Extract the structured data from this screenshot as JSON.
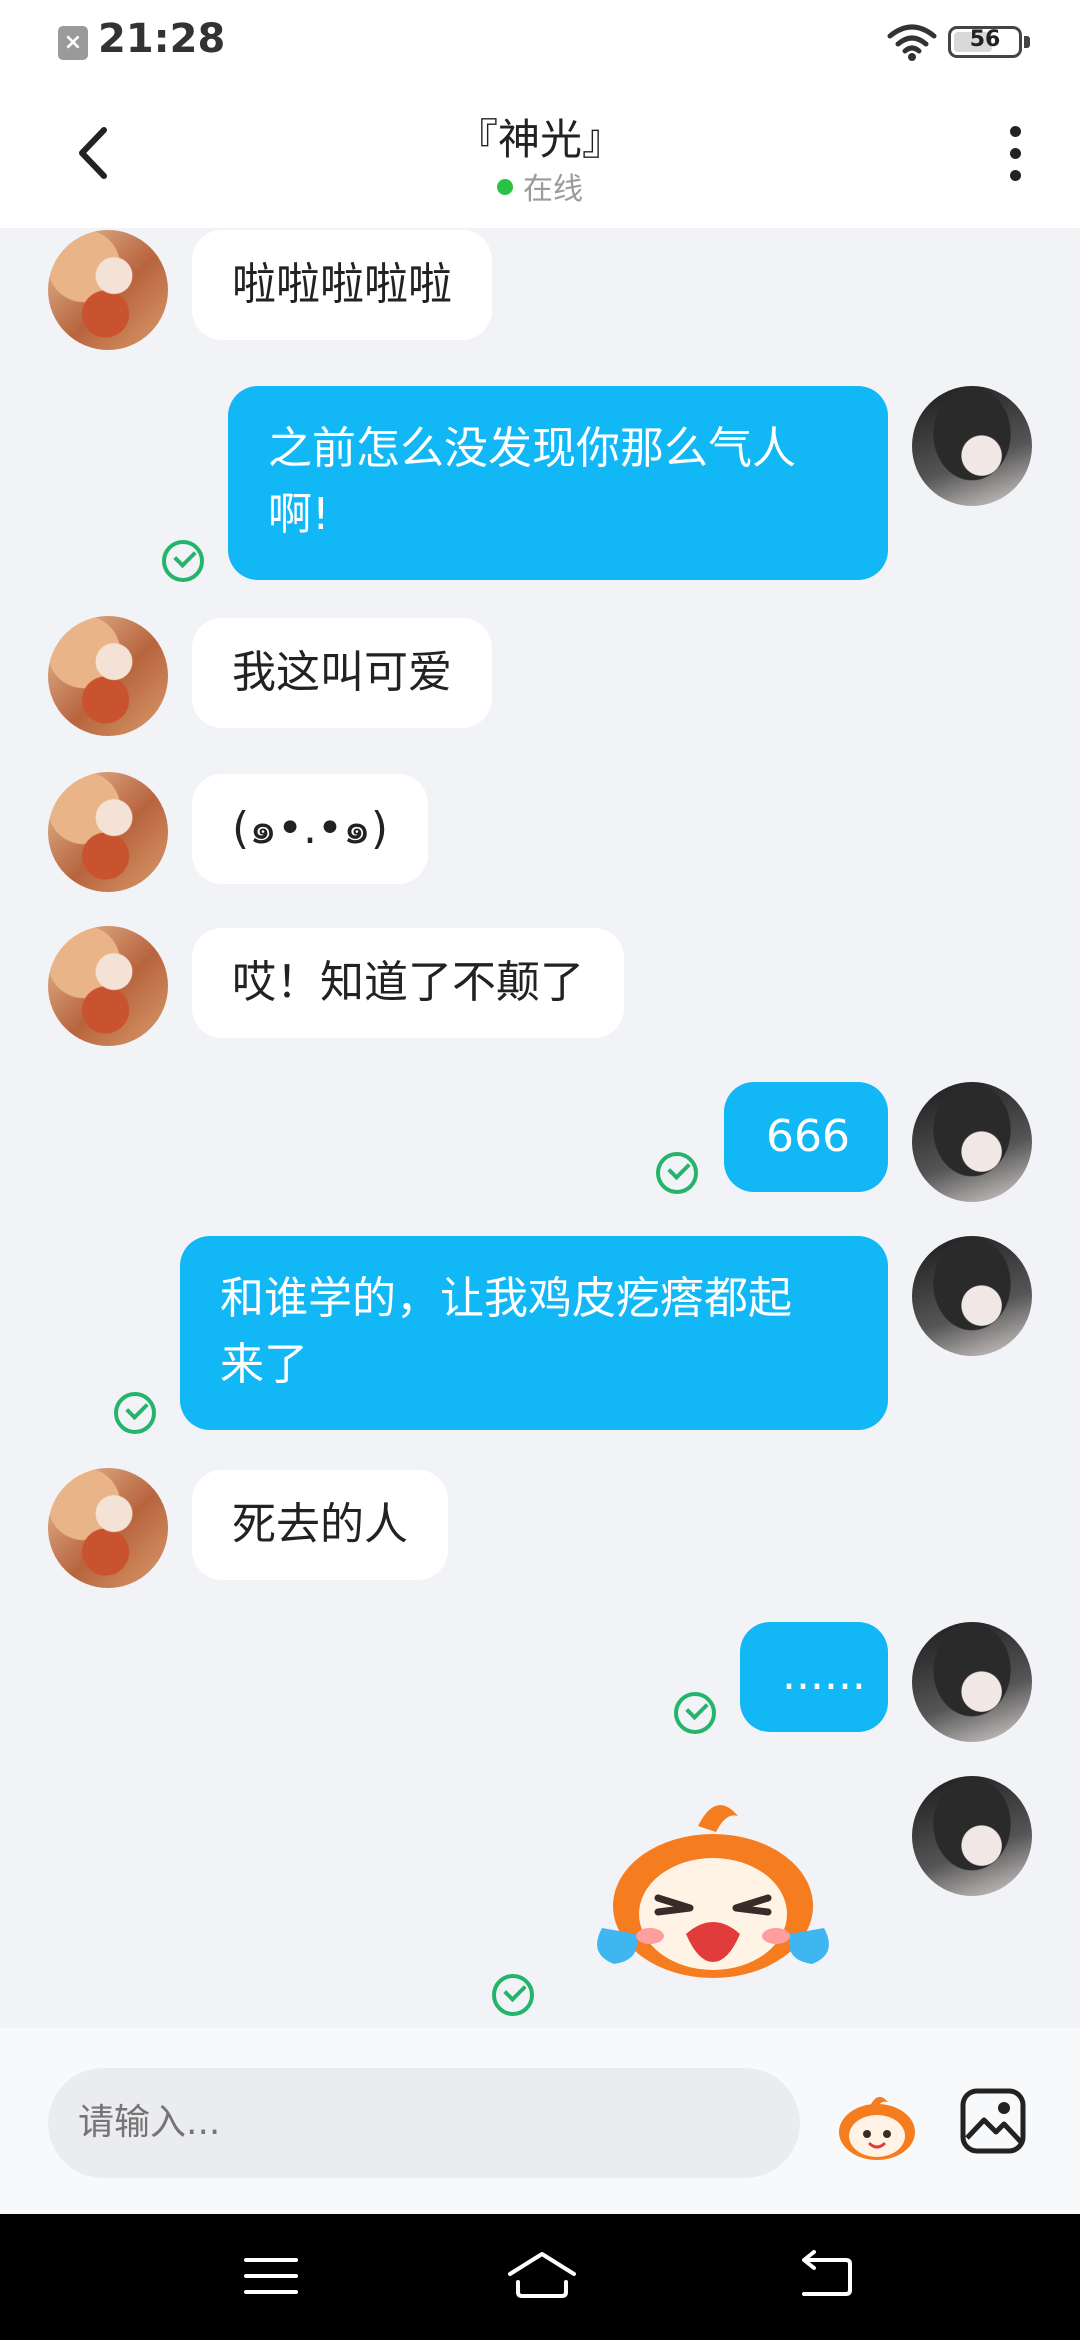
{
  "status_bar": {
    "time": "21:28",
    "battery": "56",
    "notification_icon": "x-icon",
    "wifi_icon": "wifi-icon"
  },
  "header": {
    "title": "『神光』",
    "status": "在线",
    "back_icon": "chevron-left-icon",
    "more_icon": "more-vertical-icon"
  },
  "colors": {
    "outgoing_bubble": "#12b7f5",
    "incoming_bubble": "#ffffff",
    "read_check": "#25b56a",
    "online_dot": "#29c244"
  },
  "messages": [
    {
      "from": "friend",
      "text": "啦啦啦啦啦"
    },
    {
      "from": "me",
      "lines": [
        "之前怎么没发现你那么气人",
        "啊!"
      ],
      "status": "read"
    },
    {
      "from": "friend",
      "text": "我这叫可爱"
    },
    {
      "from": "friend",
      "text": "(๑•.•๑)"
    },
    {
      "from": "friend",
      "text": "哎！知道了不颠了"
    },
    {
      "from": "me",
      "text": "666",
      "status": "read"
    },
    {
      "from": "me",
      "lines": [
        "和谁学的，让我鸡皮疙瘩都起",
        "来了"
      ],
      "status": "read"
    },
    {
      "from": "friend",
      "text": "死去的人"
    },
    {
      "from": "me",
      "text": "......",
      "status": "read"
    },
    {
      "from": "me",
      "sticker": "crying-mascot-sticker",
      "status": "read"
    }
  ],
  "input": {
    "placeholder": "请输入..."
  },
  "toolbar": {
    "emoji_icon": "mascot-emoji-icon",
    "image_icon": "image-icon"
  },
  "navbar": {
    "menu_icon": "menu-icon",
    "home_icon": "home-icon",
    "back_icon": "back-icon"
  }
}
